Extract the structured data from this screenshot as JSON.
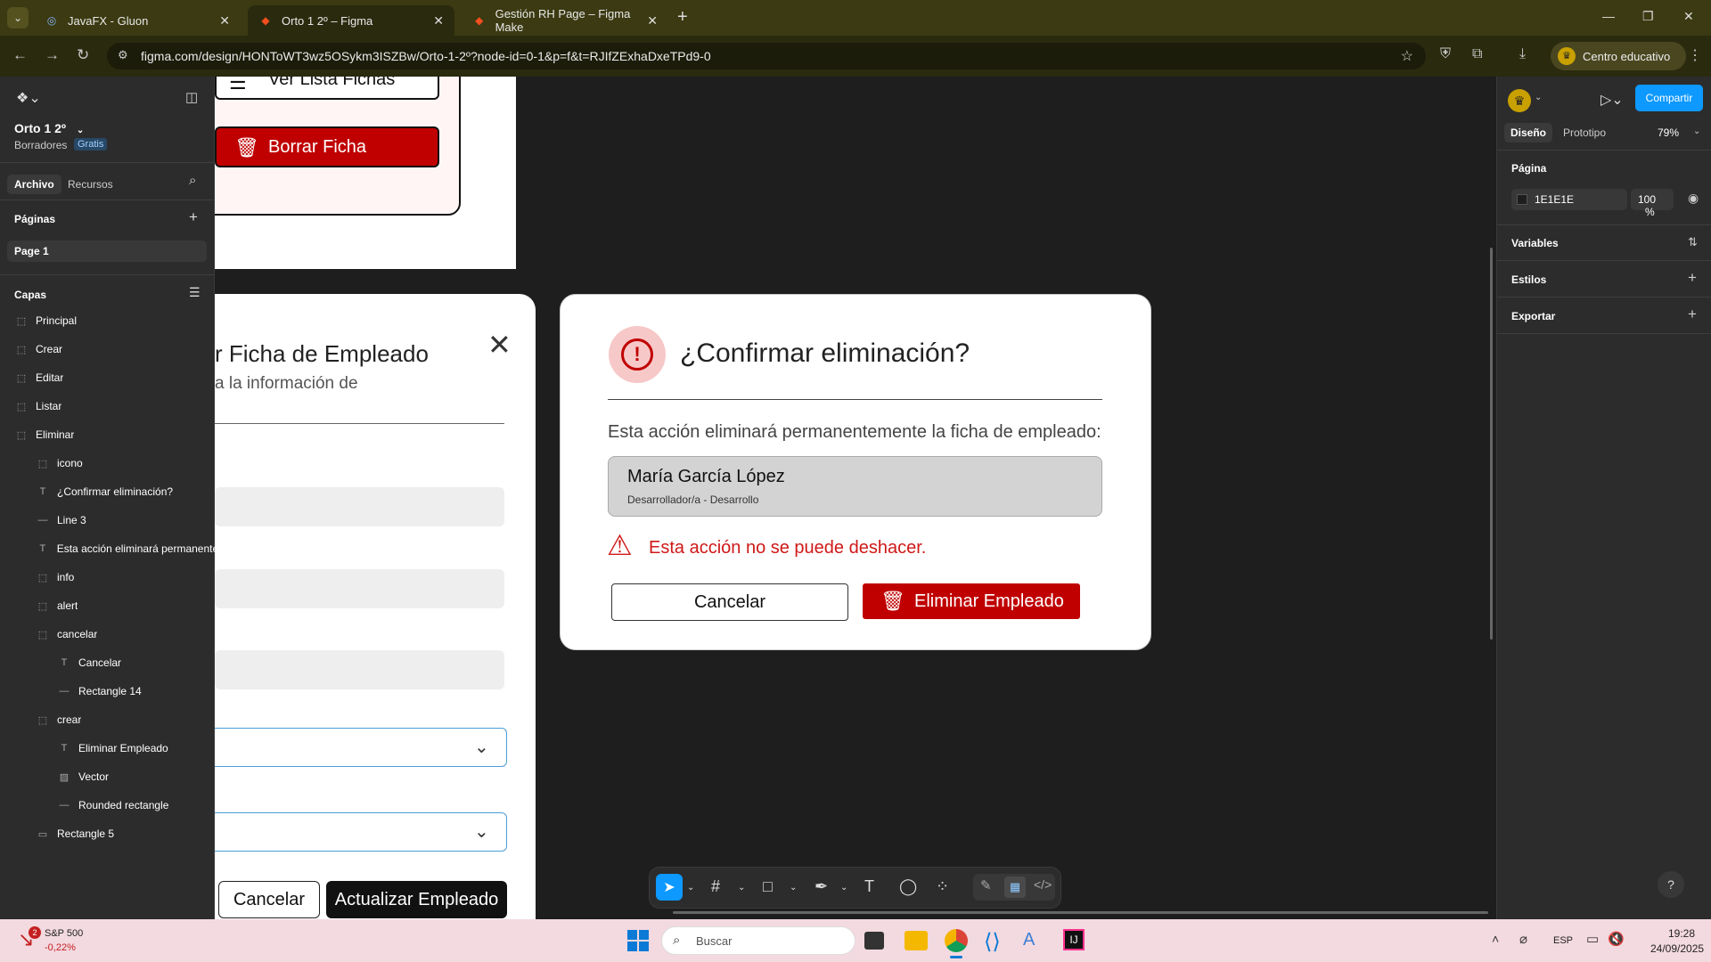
{
  "browser": {
    "tabs": [
      {
        "title": "JavaFX - Gluon",
        "active": false
      },
      {
        "title": "Orto 1 2º – Figma",
        "active": true
      },
      {
        "title": "Gestión RH Page – Figma Make",
        "active": false
      }
    ],
    "new_tab": "+",
    "url": "figma.com/design/HONToWT3wz5OSykm3ISZBw/Orto-1-2º?node-id=0-1&p=f&t=RJIfZExhaDxeTPd9-0",
    "profile_label": "Centro educativo",
    "window_controls": [
      "—",
      "❐",
      "✕"
    ]
  },
  "figma_left": {
    "file_name": "Orto 1 2º",
    "drafts": "Borradores",
    "plan_badge": "Gratis",
    "tabs": [
      "Archivo",
      "Recursos"
    ],
    "pages_title": "Páginas",
    "pages": [
      "Page 1"
    ],
    "layers_title": "Capas",
    "layers": [
      {
        "name": "Principal",
        "depth": 0,
        "icon": "frame"
      },
      {
        "name": "Crear",
        "depth": 0,
        "icon": "frame"
      },
      {
        "name": "Editar",
        "depth": 0,
        "icon": "frame"
      },
      {
        "name": "Listar",
        "depth": 0,
        "icon": "frame"
      },
      {
        "name": "Eliminar",
        "depth": 0,
        "icon": "frame"
      },
      {
        "name": "icono",
        "depth": 1,
        "icon": "frame"
      },
      {
        "name": "¿Confirmar eliminación?",
        "depth": 1,
        "icon": "text"
      },
      {
        "name": "Line 3",
        "depth": 1,
        "icon": "line"
      },
      {
        "name": "Esta acción eliminará permanente",
        "depth": 1,
        "icon": "text"
      },
      {
        "name": "info",
        "depth": 1,
        "icon": "frame"
      },
      {
        "name": "alert",
        "depth": 1,
        "icon": "frame"
      },
      {
        "name": "cancelar",
        "depth": 1,
        "icon": "frame"
      },
      {
        "name": "Cancelar",
        "depth": 2,
        "icon": "text"
      },
      {
        "name": "Rectangle 14",
        "depth": 2,
        "icon": "line"
      },
      {
        "name": "crear",
        "depth": 1,
        "icon": "frame"
      },
      {
        "name": "Eliminar Empleado",
        "depth": 2,
        "icon": "text"
      },
      {
        "name": "Vector",
        "depth": 2,
        "icon": "vector"
      },
      {
        "name": "Rounded rectangle",
        "depth": 2,
        "icon": "line"
      },
      {
        "name": "Rectangle 5",
        "depth": 1,
        "icon": "rect"
      }
    ]
  },
  "canvas": {
    "top_frame": {
      "list_button": "Ver Lista Fichas",
      "delete_button": "Borrar Ficha"
    },
    "edit_frame": {
      "title": "r Ficha de Empleado",
      "subtitle": "a la información de",
      "cancel": "Cancelar",
      "update": "Actualizar Empleado"
    },
    "delete_frame": {
      "title": "¿Confirmar eliminación?",
      "body": "Esta acción eliminará permanentemente la ficha de empleado:",
      "employee_name": "María García López",
      "employee_role": "Desarrollador/a - Desarrollo",
      "warning": "Esta acción no se puede deshacer.",
      "cancel": "Cancelar",
      "confirm": "Eliminar Empleado"
    }
  },
  "figma_right": {
    "share": "Compartir",
    "tabs": [
      "Diseño",
      "Prototipo"
    ],
    "zoom": "79%",
    "page_section": "Página",
    "page_color": "1E1E1E",
    "page_opacity": "100",
    "percent": "%",
    "sections": [
      "Variables",
      "Estilos",
      "Exportar"
    ],
    "help": "?"
  },
  "taskbar": {
    "stock_name": "S&P 500",
    "stock_change": "-0,22%",
    "stock_badge": "2",
    "search_placeholder": "Buscar",
    "lang": "ESP",
    "time": "19:28",
    "date": "24/09/2025"
  },
  "colors": {
    "danger": "#c00000",
    "canvas": "#1e1e1e",
    "figma_blue": "#0d99ff"
  }
}
